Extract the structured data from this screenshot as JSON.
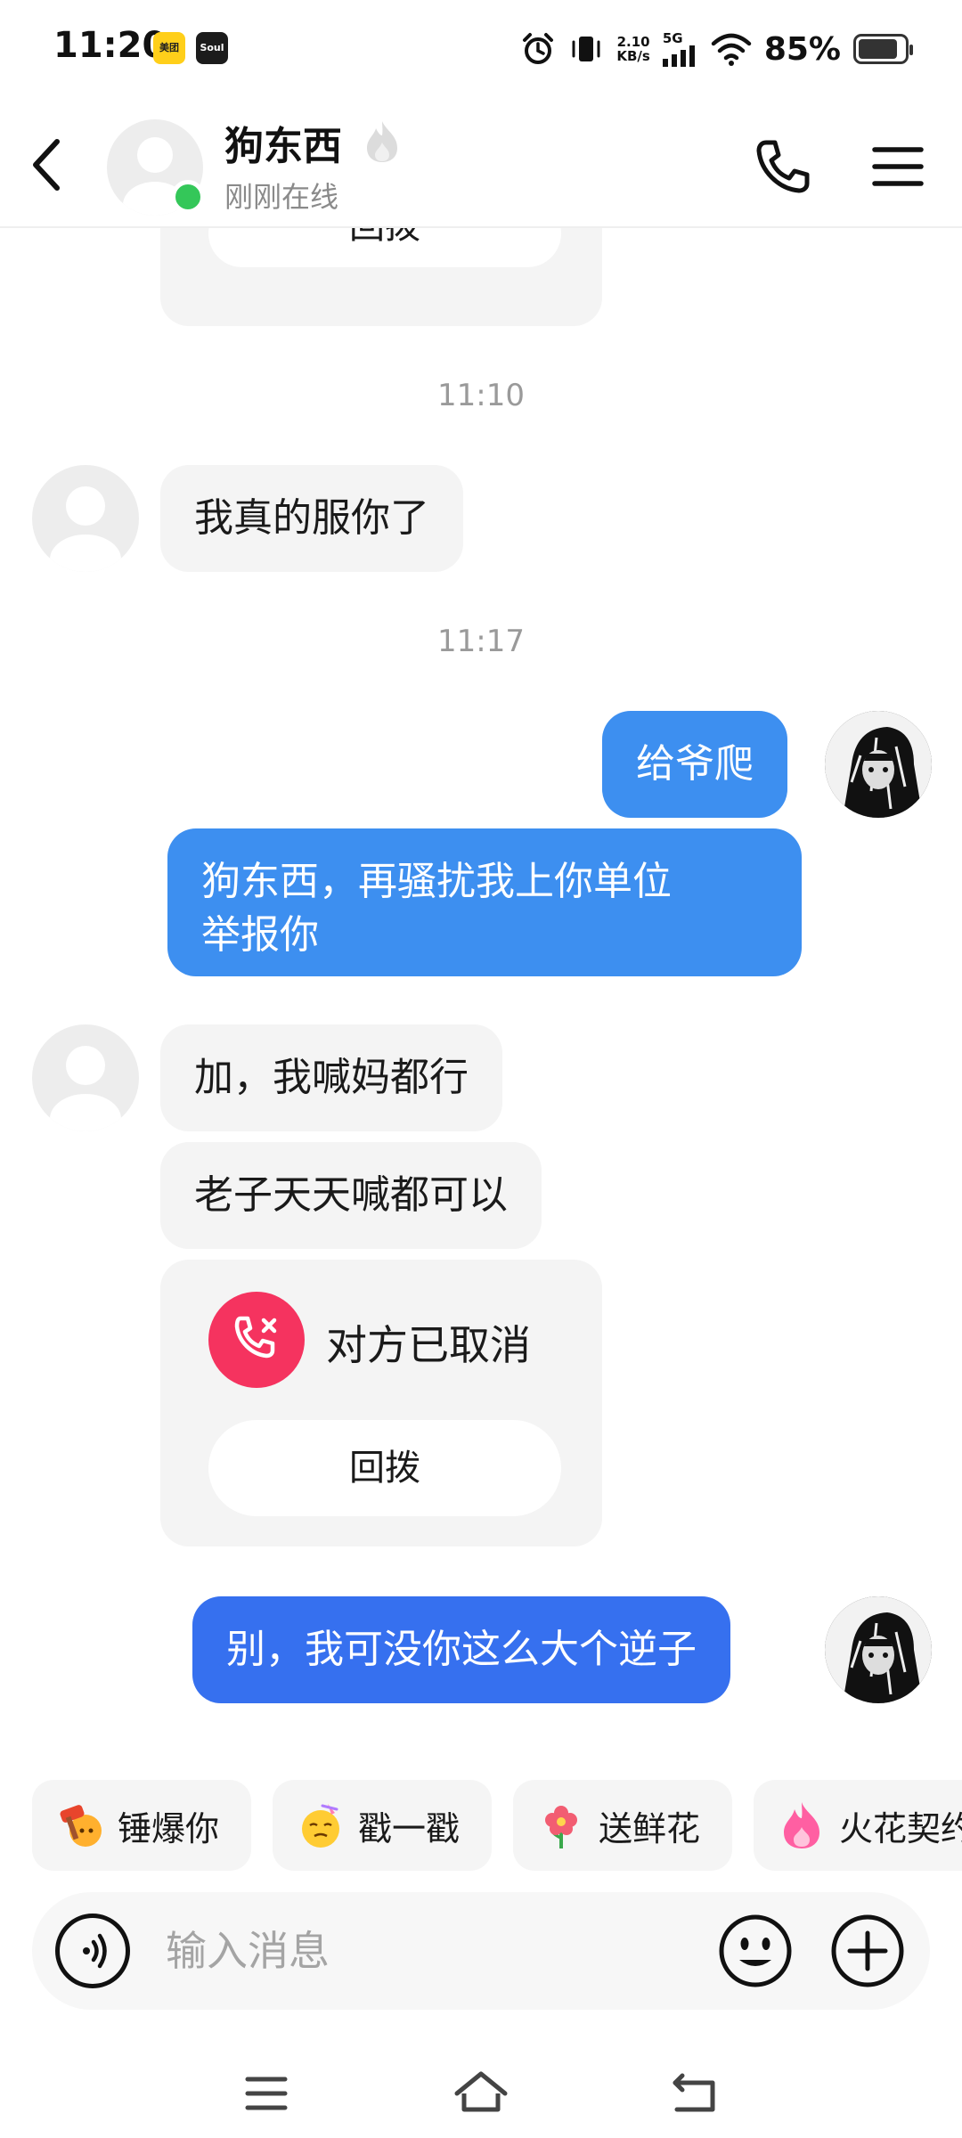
{
  "status_bar": {
    "time": "11:20",
    "apps": [
      {
        "name": "meituan",
        "label": "美团"
      },
      {
        "name": "soul",
        "label": "Soul"
      }
    ],
    "net_speed_value": "2.10",
    "net_speed_unit": "KB/s",
    "network": "5G",
    "battery_percent": "85%",
    "battery_level": 0.85
  },
  "header": {
    "contact_name": "狗东西",
    "status": "刚刚在线",
    "online": true
  },
  "messages": {
    "top_card_redial": "回拨",
    "time_1": "11:10",
    "in_1": "我真的服你了",
    "time_2": "11:17",
    "out_1": "给爷爬",
    "out_2_line1": "狗东西，再骚扰我上你单位",
    "out_2_line2": "举报你",
    "in_2": "加，我喊妈都行",
    "in_3": "老子天天喊都可以",
    "call_status": "对方已取消",
    "call_redial": "回拨",
    "out_3": "别，我可没你这么大个逆子"
  },
  "quick_actions": [
    {
      "label": "锤爆你",
      "icon": "hammer-emoji-icon"
    },
    {
      "label": "戳一戳",
      "icon": "poke-face-icon"
    },
    {
      "label": "送鲜花",
      "icon": "flower-icon"
    },
    {
      "label": "火花契约",
      "icon": "flame-icon"
    }
  ],
  "input": {
    "placeholder": "输入消息",
    "value": ""
  },
  "colors": {
    "outgoing_bubble": "#3d8ff0",
    "outgoing_bubble_alt": "#3670ef",
    "incoming_bubble": "#f4f4f4",
    "online_dot": "#34c759",
    "missed_call": "#f5335f"
  }
}
